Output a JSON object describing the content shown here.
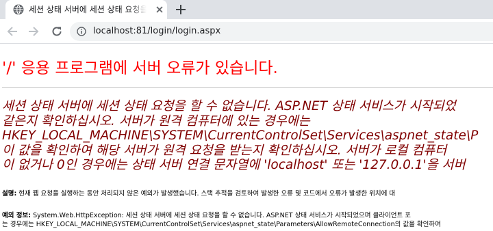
{
  "browser": {
    "tab_title": "세션 상태 서버에 세션 상태 요청을 할 수 없습니다",
    "url_host": "localhost",
    "url_rest": ":81/login/login.aspx"
  },
  "page": {
    "heading": "'/' 응용 프로그램에 서버 오류가 있습니다.",
    "error_lines": [
      "세션 상태 서버에 세션 상태 요청을 할 수 없습니다. ASP.NET 상태 서비스가 시작되었",
      "같은지 확인하십시오. 서버가 원격 컴퓨터에 있는 경우에는",
      "HKEY_LOCAL_MACHINE\\SYSTEM\\CurrentControlSet\\Services\\aspnet_state\\P",
      "이 값을 확인하여 해당 서버가 원격 요청을 받는지 확인하십시오. 서버가 로컬 컴퓨터",
      "이 없거나 0인 경우에는 상태 서버 연결 문자열에 'localhost' 또는 '127.0.0.1'을 서버"
    ],
    "description_label": "설명:",
    "description_text": " 현재 웹 요청을 실행하는 동안 처리되지 않은 예외가 발생했습니다. 스택 추적을 검토하여 발생한 오류 및 코드에서 오류가 발생한 위치에 대",
    "exception_label": "예외 정보:",
    "exception_line1": " System.Web.HttpException: 세션 상태 서버에 세션 상태 요청을 할 수 없습니다. ASP.NET 상태 서비스가 시작되었으며 클라이언트 포",
    "exception_line2": "는 경우에는 HKEY_LOCAL_MACHINE\\SYSTEM\\CurrentControlSet\\Services\\aspnet_state\\Parameters\\AllowRemoteConnection의 값을 확인하여"
  }
}
